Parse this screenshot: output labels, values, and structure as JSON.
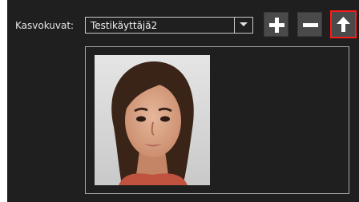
{
  "face_picker": {
    "label": "Kasvokuvat:",
    "selected_value": "Testikäyttäjä2",
    "buttons": {
      "add": "plus-icon",
      "remove": "minus-icon",
      "upload": "arrow-up-icon"
    }
  },
  "colors": {
    "panel_bg": "#1f1f1f",
    "button_bg": "#4a4a4a",
    "highlight": "#ff1a1a",
    "border": "#a8a8a8"
  }
}
